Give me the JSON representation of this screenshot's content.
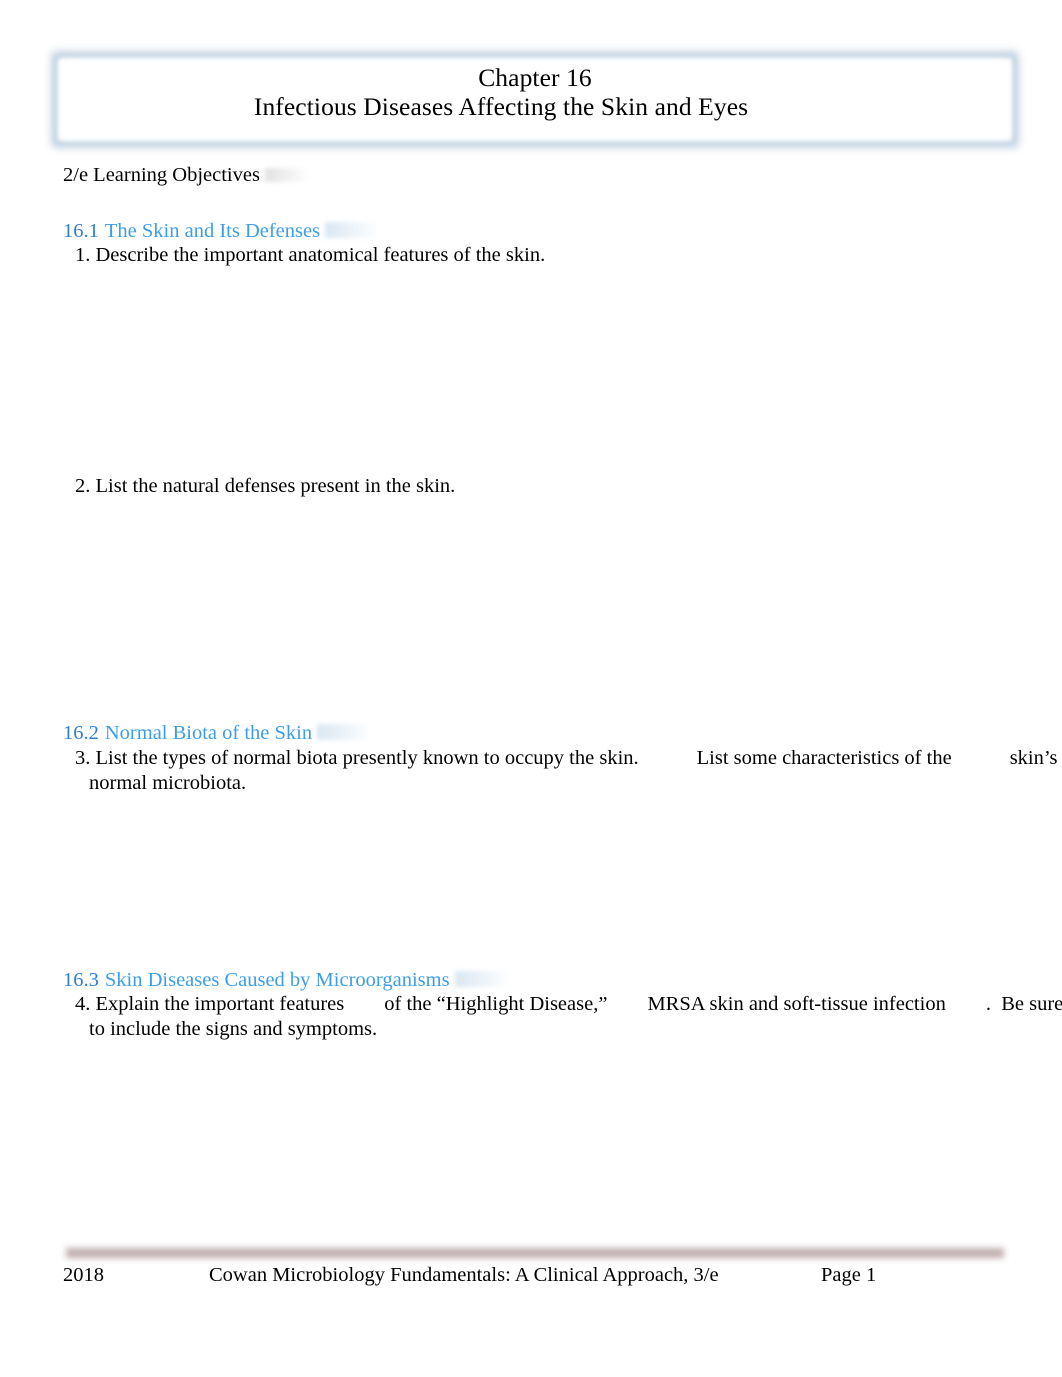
{
  "document": {
    "title_box": {
      "line1": "Chapter 16",
      "line2": "Infectious Diseases Affecting the Skin and Eyes",
      "border_color": "#aac3d8"
    },
    "intro": "2/e Learning Objectives",
    "heading_color": "#3c9ee8",
    "sections": [
      {
        "number": "16.1",
        "title": "The Skin and Its Defenses",
        "objectives": [
          {
            "number": "1.",
            "line1_a": "1. Describe the important anatomical features of the skin.",
            "line1_b": "",
            "line1_c": "",
            "line2": ""
          },
          {
            "number": "2.",
            "line1_a": "2. List the natural defenses present in the skin.",
            "line1_b": "",
            "line1_c": "",
            "line2": ""
          }
        ]
      },
      {
        "number": "16.2",
        "title": "Normal Biota of the Skin",
        "objectives": [
          {
            "number": "3.",
            "line1_a": "3. List the types of normal biota presently known to occupy the skin.",
            "line1_b": "List some characteristics of the",
            "line1_c": "skin’s",
            "line2": "normal microbiota."
          }
        ]
      },
      {
        "number": "16.3",
        "title": "Skin Diseases Caused by Microorganisms",
        "objectives": [
          {
            "number": "4.",
            "line1_a": "4. Explain the important features",
            "line1_b": "of the “Highlight Disease,”",
            "line1_c": "MRSA skin and soft-tissue infection",
            "line1_d": ".  Be sure",
            "line2": "to include the signs and symptoms."
          }
        ]
      }
    ],
    "footer": {
      "year": "2018",
      "book": "Cowan Microbiology Fundamentals:  A Clinical Approach, 3/e",
      "page": "Page 1",
      "rule_color": "#bca9ab"
    }
  }
}
